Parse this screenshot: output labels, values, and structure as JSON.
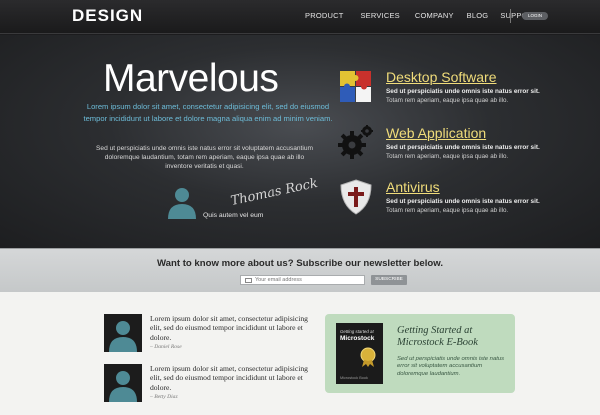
{
  "header": {
    "logo": "DESIGN",
    "nav": [
      "PRODUCT",
      "SERVICES",
      "COMPANY",
      "BLOG",
      "SUPPORT"
    ],
    "login": "LOGIN"
  },
  "hero": {
    "title": "Marvelous",
    "lead": "Lorem ipsum dolor sit amet, consectetur adipisicing elit, sed do eiusmod tempor incididunt ut labore et dolore magna aliqua  enim ad minim veniam.",
    "body": "Sed ut perspiciatis unde omnis iste natus error sit voluptatem accusantium doloremque laudantium, totam rem aperiam, eaque ipsa quae ab illo inventore veritatis et quasi.",
    "signature": "Thomas Rock",
    "author_caption": "Quis autem vel eum"
  },
  "features": [
    {
      "title": "Desktop Software",
      "line1": "Sed ut perspiciatis unde omnis iste natus error sit.",
      "line2": "Totam rem aperiam, eaque ipsa quae ab illo.",
      "icon": "puzzle-icon"
    },
    {
      "title": "Web Application",
      "line1": "Sed ut perspiciatis unde omnis iste natus error sit.",
      "line2": "Totam rem aperiam, eaque ipsa quae ab illo.",
      "icon": "gears-icon"
    },
    {
      "title": "Antivirus",
      "line1": "Sed ut perspiciatis unde omnis iste natus error sit.",
      "line2": "Totam rem aperiam, eaque ipsa quae ab illo.",
      "icon": "shield-icon"
    }
  ],
  "newsletter": {
    "title": "Want to know more about us? Subscribe our newsletter below.",
    "placeholder": "Your email address",
    "button": "SUBSCRIBE"
  },
  "testimonials": [
    {
      "text": "Lorem ipsum dolor sit amet, consectetur adipisicing elit, sed do eiusmod tempor incididunt ut labore et dolore.",
      "author": "– Daniel Rose"
    },
    {
      "text": "Lorem ipsum dolor sit amet, consectetur adipisicing elit, sed do eiusmod tempor incididunt ut labore et dolore.",
      "author": "– Betty Diaz"
    }
  ],
  "ebook": {
    "cover_small": "Getting started at",
    "cover_title": "Microstock",
    "cover_footer": "Microstock Book",
    "title": "Getting Started at Microstock E-Book",
    "text": "Sed ut perspiciatis unde omnis iste natus error sit voluptatem accusantium doloremque laudantium."
  },
  "colors": {
    "accent_blue": "#6dbcd8",
    "feature_title": "#f0dc7a",
    "ebook_bg": "#bfdbbe"
  }
}
